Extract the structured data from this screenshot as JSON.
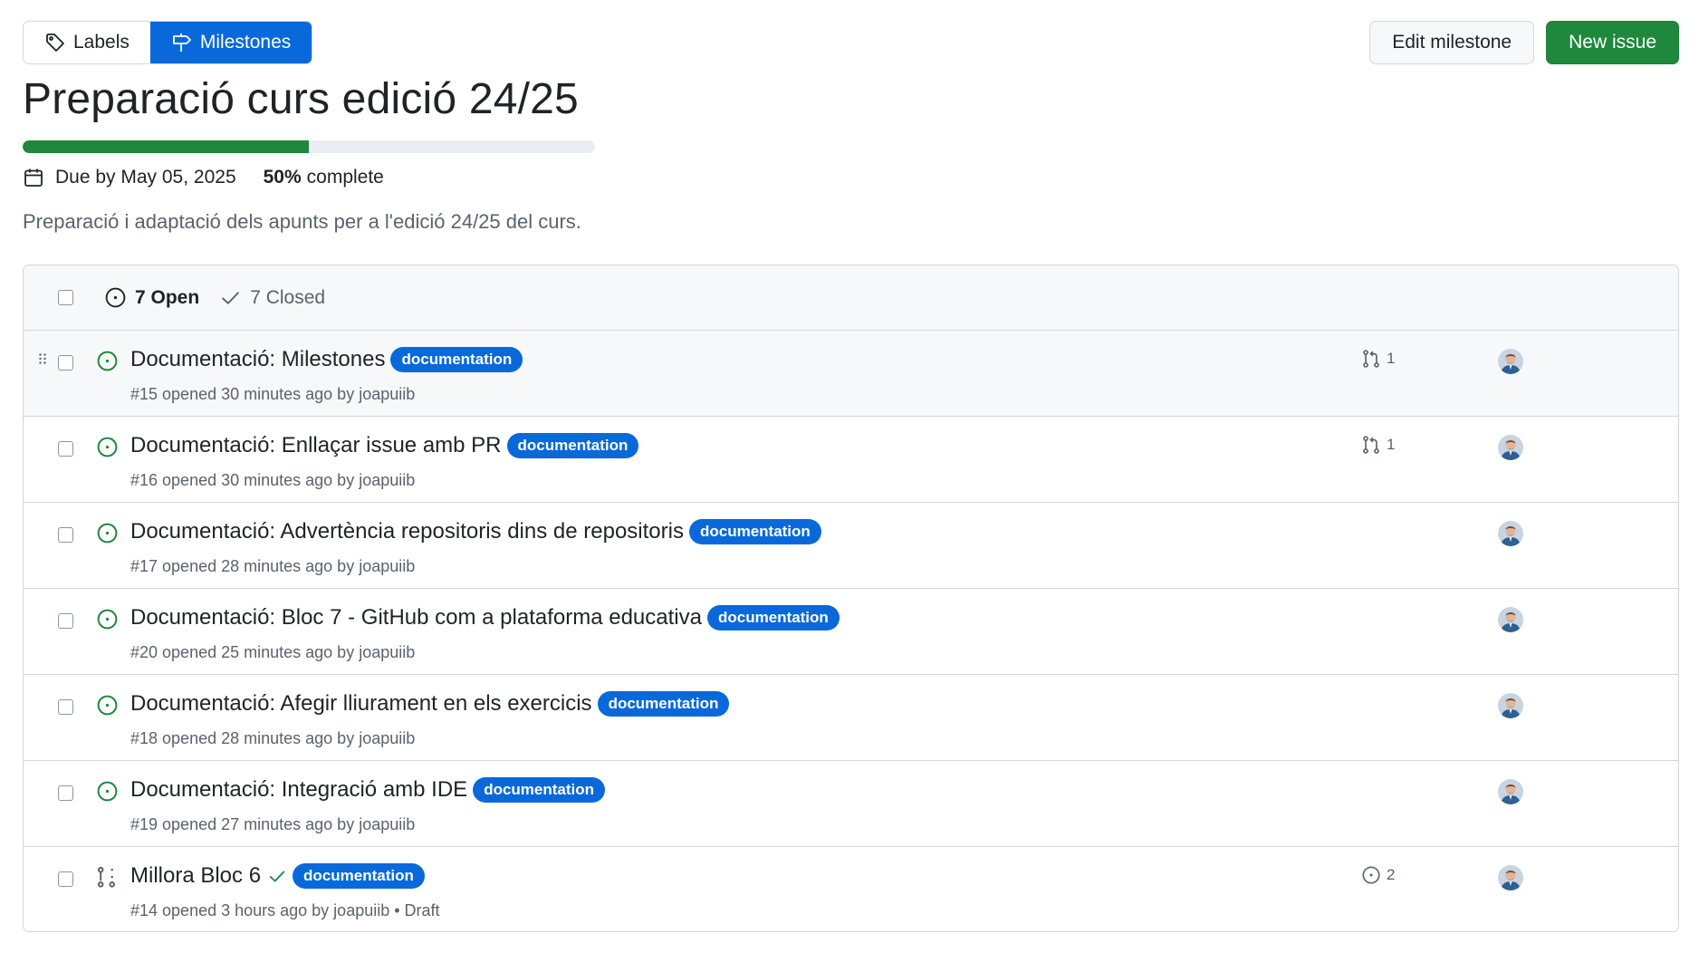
{
  "nav": {
    "labels_tab": "Labels",
    "milestones_tab": "Milestones"
  },
  "actions": {
    "edit_milestone": "Edit milestone",
    "new_issue": "New issue"
  },
  "milestone": {
    "title": "Preparació curs edició 24/25",
    "progress_fraction": 0.5,
    "due": "Due by May 05, 2025",
    "percent": "50%",
    "complete_label": "complete",
    "description": "Preparació i adaptació dels apunts per a l'edició 24/25 del curs."
  },
  "issues_header": {
    "open": "7 Open",
    "closed": "7 Closed"
  },
  "issues": [
    {
      "title": "Documentació: Milestones",
      "label": "documentation",
      "sub": "#15 opened 30 minutes ago by joapuiib",
      "linked": "1",
      "linked_icon": "pull-request-icon",
      "type": "issue"
    },
    {
      "title": "Documentació: Enllaçar issue amb PR",
      "label": "documentation",
      "sub": "#16 opened 30 minutes ago by joapuiib",
      "linked": "1",
      "linked_icon": "pull-request-icon",
      "type": "issue"
    },
    {
      "title": "Documentació: Advertència repositoris dins de repositoris",
      "label": "documentation",
      "sub": "#17 opened 28 minutes ago by joapuiib",
      "linked": "",
      "type": "issue"
    },
    {
      "title": "Documentació: Bloc 7 - GitHub com a plataforma educativa",
      "label": "documentation",
      "sub": "#20 opened 25 minutes ago by joapuiib",
      "linked": "",
      "type": "issue"
    },
    {
      "title": "Documentació: Afegir lliurament en els exercicis",
      "label": "documentation",
      "sub": "#18 opened 28 minutes ago by joapuiib",
      "linked": "",
      "type": "issue"
    },
    {
      "title": "Documentació: Integració amb IDE",
      "label": "documentation",
      "sub": "#19 opened 27 minutes ago by joapuiib",
      "linked": "",
      "type": "issue"
    },
    {
      "title": "Millora Bloc 6",
      "label": "documentation",
      "sub": "#14 opened 3 hours ago by joapuiib • Draft",
      "linked": "2",
      "linked_icon": "issue-icon",
      "type": "draft-pr"
    }
  ],
  "colors": {
    "accent": "#0969da",
    "success": "#1f883d",
    "muted": "#59636e"
  }
}
